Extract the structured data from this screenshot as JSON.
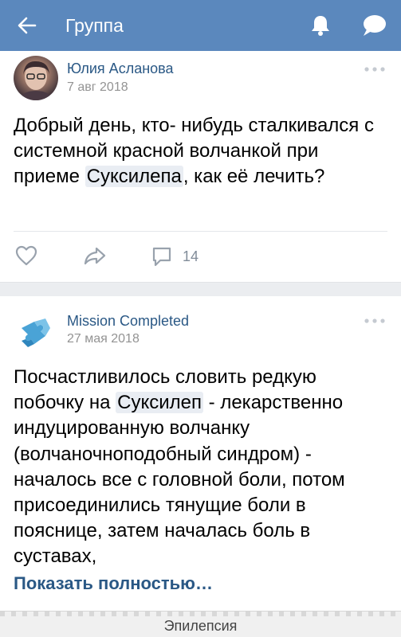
{
  "header": {
    "title": "Группа",
    "back_icon": "arrow-left-icon",
    "bell_icon": "bell-icon",
    "chat_icon": "chat-bubble-icon",
    "color": "#5b88bd"
  },
  "posts": [
    {
      "author": "Юлия Асланова",
      "date": "7 авг 2018",
      "text_before": "Добрый день, кто- нибудь сталкивался с системной красной волчанкой при приеме ",
      "highlight": "Суксилепа",
      "text_after": ", как её лечить?",
      "comments_count": "14"
    },
    {
      "author": "Mission Completed",
      "date": "27 мая 2018",
      "text_before": "Посчастливилось словить редкую побочку на ",
      "highlight": "Суксилеп",
      "text_after": " - лекарственно индуцированную волчанку (волчаночноподобный синдром) - началось все с головной боли, потом присоединились тянущие боли в пояснице, затем началась боль в суставах,",
      "show_more": "Показать полностью…"
    }
  ],
  "bottom_bar": {
    "label": "Эпилепсия"
  },
  "colors": {
    "link": "#2a5885",
    "meta": "#939393",
    "highlight_bg": "#e9edf3"
  }
}
